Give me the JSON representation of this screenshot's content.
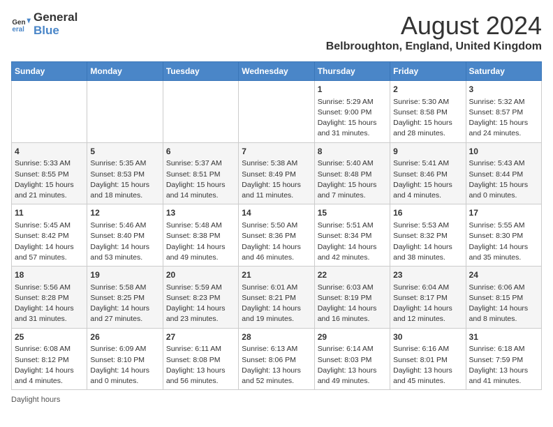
{
  "header": {
    "logo_line1": "General",
    "logo_line2": "Blue",
    "month_year": "August 2024",
    "location": "Belbroughton, England, United Kingdom"
  },
  "days_of_week": [
    "Sunday",
    "Monday",
    "Tuesday",
    "Wednesday",
    "Thursday",
    "Friday",
    "Saturday"
  ],
  "weeks": [
    [
      {
        "day": "",
        "info": ""
      },
      {
        "day": "",
        "info": ""
      },
      {
        "day": "",
        "info": ""
      },
      {
        "day": "",
        "info": ""
      },
      {
        "day": "1",
        "info": "Sunrise: 5:29 AM\nSunset: 9:00 PM\nDaylight: 15 hours\nand 31 minutes."
      },
      {
        "day": "2",
        "info": "Sunrise: 5:30 AM\nSunset: 8:58 PM\nDaylight: 15 hours\nand 28 minutes."
      },
      {
        "day": "3",
        "info": "Sunrise: 5:32 AM\nSunset: 8:57 PM\nDaylight: 15 hours\nand 24 minutes."
      }
    ],
    [
      {
        "day": "4",
        "info": "Sunrise: 5:33 AM\nSunset: 8:55 PM\nDaylight: 15 hours\nand 21 minutes."
      },
      {
        "day": "5",
        "info": "Sunrise: 5:35 AM\nSunset: 8:53 PM\nDaylight: 15 hours\nand 18 minutes."
      },
      {
        "day": "6",
        "info": "Sunrise: 5:37 AM\nSunset: 8:51 PM\nDaylight: 15 hours\nand 14 minutes."
      },
      {
        "day": "7",
        "info": "Sunrise: 5:38 AM\nSunset: 8:49 PM\nDaylight: 15 hours\nand 11 minutes."
      },
      {
        "day": "8",
        "info": "Sunrise: 5:40 AM\nSunset: 8:48 PM\nDaylight: 15 hours\nand 7 minutes."
      },
      {
        "day": "9",
        "info": "Sunrise: 5:41 AM\nSunset: 8:46 PM\nDaylight: 15 hours\nand 4 minutes."
      },
      {
        "day": "10",
        "info": "Sunrise: 5:43 AM\nSunset: 8:44 PM\nDaylight: 15 hours\nand 0 minutes."
      }
    ],
    [
      {
        "day": "11",
        "info": "Sunrise: 5:45 AM\nSunset: 8:42 PM\nDaylight: 14 hours\nand 57 minutes."
      },
      {
        "day": "12",
        "info": "Sunrise: 5:46 AM\nSunset: 8:40 PM\nDaylight: 14 hours\nand 53 minutes."
      },
      {
        "day": "13",
        "info": "Sunrise: 5:48 AM\nSunset: 8:38 PM\nDaylight: 14 hours\nand 49 minutes."
      },
      {
        "day": "14",
        "info": "Sunrise: 5:50 AM\nSunset: 8:36 PM\nDaylight: 14 hours\nand 46 minutes."
      },
      {
        "day": "15",
        "info": "Sunrise: 5:51 AM\nSunset: 8:34 PM\nDaylight: 14 hours\nand 42 minutes."
      },
      {
        "day": "16",
        "info": "Sunrise: 5:53 AM\nSunset: 8:32 PM\nDaylight: 14 hours\nand 38 minutes."
      },
      {
        "day": "17",
        "info": "Sunrise: 5:55 AM\nSunset: 8:30 PM\nDaylight: 14 hours\nand 35 minutes."
      }
    ],
    [
      {
        "day": "18",
        "info": "Sunrise: 5:56 AM\nSunset: 8:28 PM\nDaylight: 14 hours\nand 31 minutes."
      },
      {
        "day": "19",
        "info": "Sunrise: 5:58 AM\nSunset: 8:25 PM\nDaylight: 14 hours\nand 27 minutes."
      },
      {
        "day": "20",
        "info": "Sunrise: 5:59 AM\nSunset: 8:23 PM\nDaylight: 14 hours\nand 23 minutes."
      },
      {
        "day": "21",
        "info": "Sunrise: 6:01 AM\nSunset: 8:21 PM\nDaylight: 14 hours\nand 19 minutes."
      },
      {
        "day": "22",
        "info": "Sunrise: 6:03 AM\nSunset: 8:19 PM\nDaylight: 14 hours\nand 16 minutes."
      },
      {
        "day": "23",
        "info": "Sunrise: 6:04 AM\nSunset: 8:17 PM\nDaylight: 14 hours\nand 12 minutes."
      },
      {
        "day": "24",
        "info": "Sunrise: 6:06 AM\nSunset: 8:15 PM\nDaylight: 14 hours\nand 8 minutes."
      }
    ],
    [
      {
        "day": "25",
        "info": "Sunrise: 6:08 AM\nSunset: 8:12 PM\nDaylight: 14 hours\nand 4 minutes."
      },
      {
        "day": "26",
        "info": "Sunrise: 6:09 AM\nSunset: 8:10 PM\nDaylight: 14 hours\nand 0 minutes."
      },
      {
        "day": "27",
        "info": "Sunrise: 6:11 AM\nSunset: 8:08 PM\nDaylight: 13 hours\nand 56 minutes."
      },
      {
        "day": "28",
        "info": "Sunrise: 6:13 AM\nSunset: 8:06 PM\nDaylight: 13 hours\nand 52 minutes."
      },
      {
        "day": "29",
        "info": "Sunrise: 6:14 AM\nSunset: 8:03 PM\nDaylight: 13 hours\nand 49 minutes."
      },
      {
        "day": "30",
        "info": "Sunrise: 6:16 AM\nSunset: 8:01 PM\nDaylight: 13 hours\nand 45 minutes."
      },
      {
        "day": "31",
        "info": "Sunrise: 6:18 AM\nSunset: 7:59 PM\nDaylight: 13 hours\nand 41 minutes."
      }
    ]
  ],
  "footer": {
    "daylight_hours_label": "Daylight hours"
  }
}
